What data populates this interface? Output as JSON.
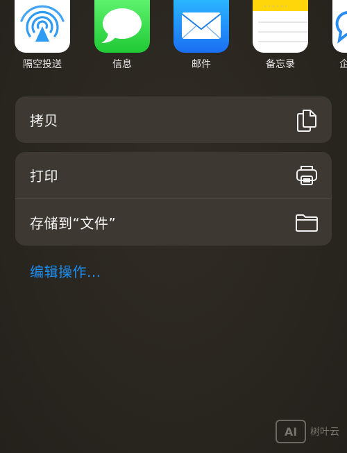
{
  "apps": [
    {
      "label": "隔空投送",
      "icon": "airdrop-icon"
    },
    {
      "label": "信息",
      "icon": "messages-icon"
    },
    {
      "label": "邮件",
      "icon": "mail-icon"
    },
    {
      "label": "备忘录",
      "icon": "notes-icon"
    },
    {
      "label": "企",
      "icon": "partial-app-icon"
    }
  ],
  "actions": {
    "copy": {
      "label": "拷贝",
      "icon": "copy-icon"
    },
    "print": {
      "label": "打印",
      "icon": "printer-icon"
    },
    "save_files": {
      "label": "存储到“文件”",
      "icon": "folder-icon"
    }
  },
  "edit_actions": {
    "label": "编辑操作..."
  },
  "watermark": {
    "logo": "AI",
    "text": "树叶云"
  },
  "colors": {
    "background": "#2a2620",
    "group_background": "#3d3831",
    "link": "#1e8df0",
    "messages_green": "#20c935",
    "mail_blue": "#1a6ff2",
    "notes_yellow": "#ffd60a"
  }
}
